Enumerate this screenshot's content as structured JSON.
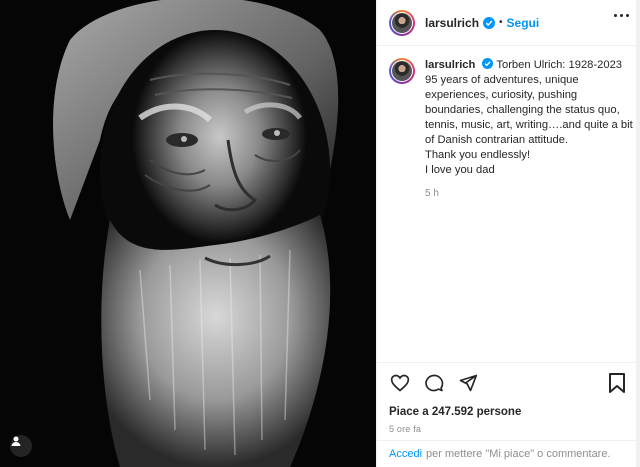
{
  "post": {
    "username": "larsulrich",
    "follow_label": "Segui",
    "separator": "•",
    "caption_lines": [
      "Torben Ulrich: 1928-2023",
      "95 years of adventures, unique experiences, curiosity, pushing boundaries, challenging the status quo, tennis, music, art, writing….and quite a bit of Danish contrarian attitude.",
      "Thank you endlessly!",
      "I love you dad"
    ],
    "caption_time": "5 h",
    "likes_text": "Piace a 247.592 persone",
    "posted_ago": "5 ore fa"
  },
  "comment": {
    "login_label": "Accedi",
    "prompt": "per mettere \"Mi piace\" o commentare."
  },
  "icons": {
    "verified": "verified-badge-icon",
    "more": "more-options-icon",
    "like": "heart-icon",
    "comment": "comment-bubble-icon",
    "share": "paper-plane-icon",
    "save": "bookmark-icon",
    "tag": "user-tag-icon"
  },
  "colors": {
    "accent": "#0095f6",
    "text": "#262626",
    "muted": "#8e8e8e",
    "verified": "#0095f6"
  }
}
